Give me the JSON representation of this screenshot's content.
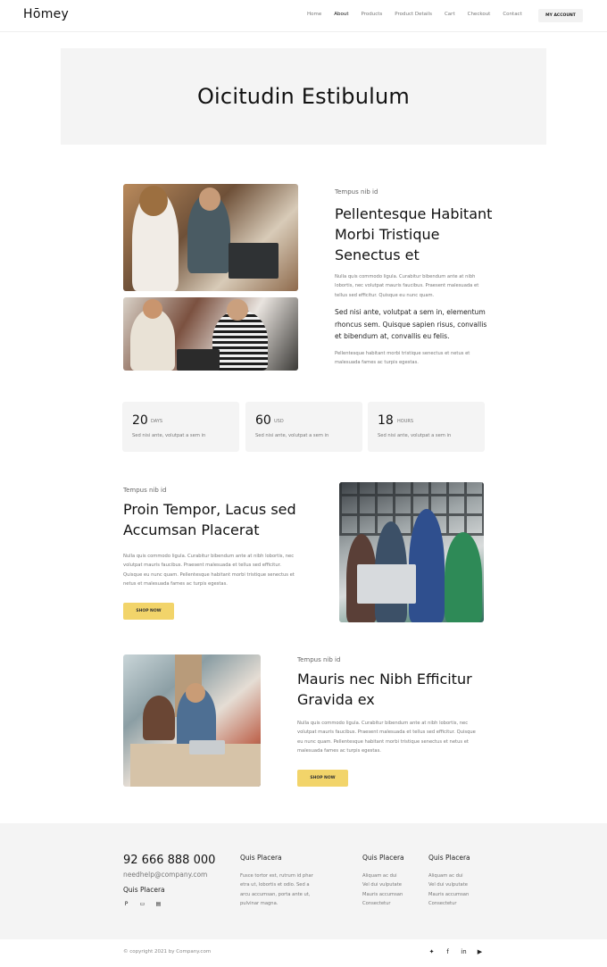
{
  "header": {
    "logo": "Hōmey",
    "nav": [
      "Home",
      "About",
      "Products",
      "Product Details",
      "Cart",
      "Checkout",
      "Contact"
    ],
    "active_nav": "About",
    "account_button": "MY ACCOUNT"
  },
  "hero": {
    "title": "Oicitudin Estibulum"
  },
  "section1": {
    "eyebrow": "Tempus nib id",
    "heading_lines": [
      "Pellentesque Habitant",
      "Morbi Tristique",
      "Senectus et"
    ],
    "para1_lines": [
      "Nulla quis commodo ligula. Curabitur bibendum ante at nibh",
      "lobortis, nec volutpat mauris faucibus. Praesent malesuada et",
      "tellus sed efficitur. Quisque eu nunc quam."
    ],
    "strong_lines": [
      "Sed nisi ante, volutpat a sem in, elementum",
      "rhoncus sem. Quisque sapien risus, convallis",
      "et bibendum at, convallis eu felis."
    ],
    "para2_lines": [
      "Pellentesque habitant morbi tristique senectus et netus et",
      "malesuada fames ac turpis egestas."
    ]
  },
  "stats": [
    {
      "value": "20",
      "unit": "DAYS",
      "desc": "Sed nisi ante, volutpat a sem in"
    },
    {
      "value": "60",
      "unit": "USD",
      "desc": "Sed nisi ante, volutpat a sem in"
    },
    {
      "value": "18",
      "unit": "HOURS",
      "desc": "Sed nisi ante, volutpat a sem in"
    }
  ],
  "section2": {
    "eyebrow": "Tempus nib id",
    "heading_lines": [
      "Proin Tempor, Lacus sed",
      "Accumsan Placerat"
    ],
    "para_lines": [
      "Nulla quis commodo ligula. Curabitur bibendum ante at nibh lobortis, nec",
      "volutpat mauris faucibus. Praesent malesuada et tellus sed efficitur.",
      "Quisque eu nunc quam. Pellentesque habitant morbi tristique senectus et",
      "netus et malesuada fames ac turpis egestas."
    ],
    "button": "SHOP NOW"
  },
  "section3": {
    "eyebrow": "Tempus nib id",
    "heading_lines": [
      "Mauris nec Nibh Efficitur",
      "Gravida ex"
    ],
    "para_lines": [
      "Nulla quis commodo ligula. Curabitur bibendum ante at nibh lobortis, nec",
      "volutpat mauris faucibus. Praesent malesuada et tellus sed efficitur. Quisque",
      "eu nunc quam. Pellentesque habitant morbi tristique senectus et netus et",
      "malesuada fames ac turpis egestas."
    ],
    "button": "SHOP NOW"
  },
  "footer": {
    "phone": "92 666 888 000",
    "email": "needhelp@company.com",
    "subtitle": "Quis Placera",
    "col1": {
      "title": "Quis Placera",
      "lines": [
        "Fusce tortor est, rutrum id phar",
        "etra ut, lobortis et odio. Sed a",
        "arcu accumsan, porta ante ut,",
        "pulvinar magna."
      ]
    },
    "col2": {
      "title": "Quis Placera",
      "lines": [
        "Aliquam ac dui",
        "Vel dui vulputate",
        "Mauris accumsan",
        "Consectetur"
      ]
    },
    "col3": {
      "title": "Quis Placera",
      "lines": [
        "Aliquam ac dui",
        "Vel dui vulputate",
        "Mauris accumsan",
        "Consectetur"
      ]
    },
    "copyright": "© copyright 2021 by Company.com"
  }
}
